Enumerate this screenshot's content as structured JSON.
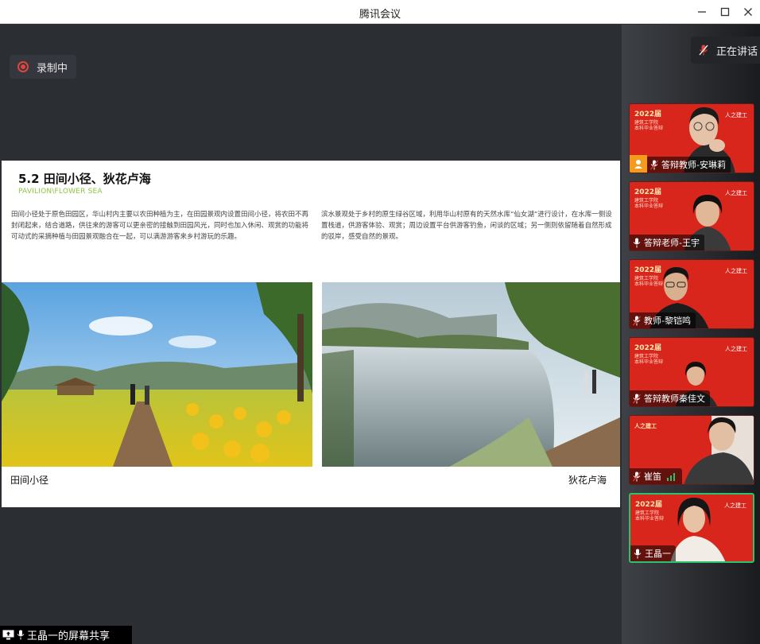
{
  "window": {
    "title": "腾讯会议",
    "minimize": "—",
    "maximize": "☐",
    "close": "✕"
  },
  "recording": {
    "label": "录制中"
  },
  "speaking": {
    "label": "正在讲话"
  },
  "slide": {
    "title": "5.2 田间小径、狄花卢海",
    "subtitle": "PAVILION\\FLOWER SEA",
    "text_left": "田间小径处于原色田园区，华山村内主要以农田种植为主，在田园景观内设置田间小径，将农田不再封闭起来，结合道路，供往来的游客可以更亲密的接触到田园风光，同时也加入休闲、观赏的功能将可动式的采摘种植与田园景观融合在一起，可以满游游客来乡村游玩的乐趣。",
    "text_right": "滨水景观处于乡村的原生绿谷区域，利用华山村原有的天然水库“仙女湖”进行设计，在水库一侧设置栈道，供游客体验、观赏；周边设置平台供游客钓鱼，闲谈的区域；另一侧则依留随着自然形成的驳岸，感受自然的景观。",
    "caption_left": "田间小径",
    "caption_right": "狄花卢海"
  },
  "participants": [
    {
      "name": "答辩教师-安琳莉",
      "talking": false,
      "has_video_icon": true
    },
    {
      "name": "答辩老师-王宇",
      "talking": false,
      "has_video_icon": false
    },
    {
      "name": "教师-黎铠鸣",
      "talking": false,
      "has_video_icon": false
    },
    {
      "name": "答辩教师秦佳文",
      "talking": false,
      "has_video_icon": false
    },
    {
      "name": "崔笛",
      "talking": true,
      "has_video_icon": false
    },
    {
      "name": "王晶一",
      "talking": false,
      "has_video_icon": false,
      "active": true
    }
  ],
  "tile_logo": {
    "year": "2022届",
    "line1": "建筑工学院",
    "line2": "本科毕业答辩",
    "mark": "人之建工"
  },
  "screen_share": {
    "label": "王晶一的屏幕共享"
  },
  "colors": {
    "tile_red": "#d9261c",
    "active_border": "#28c36a",
    "subtitle_green": "#8cc63f",
    "record_red": "#e0443e"
  }
}
